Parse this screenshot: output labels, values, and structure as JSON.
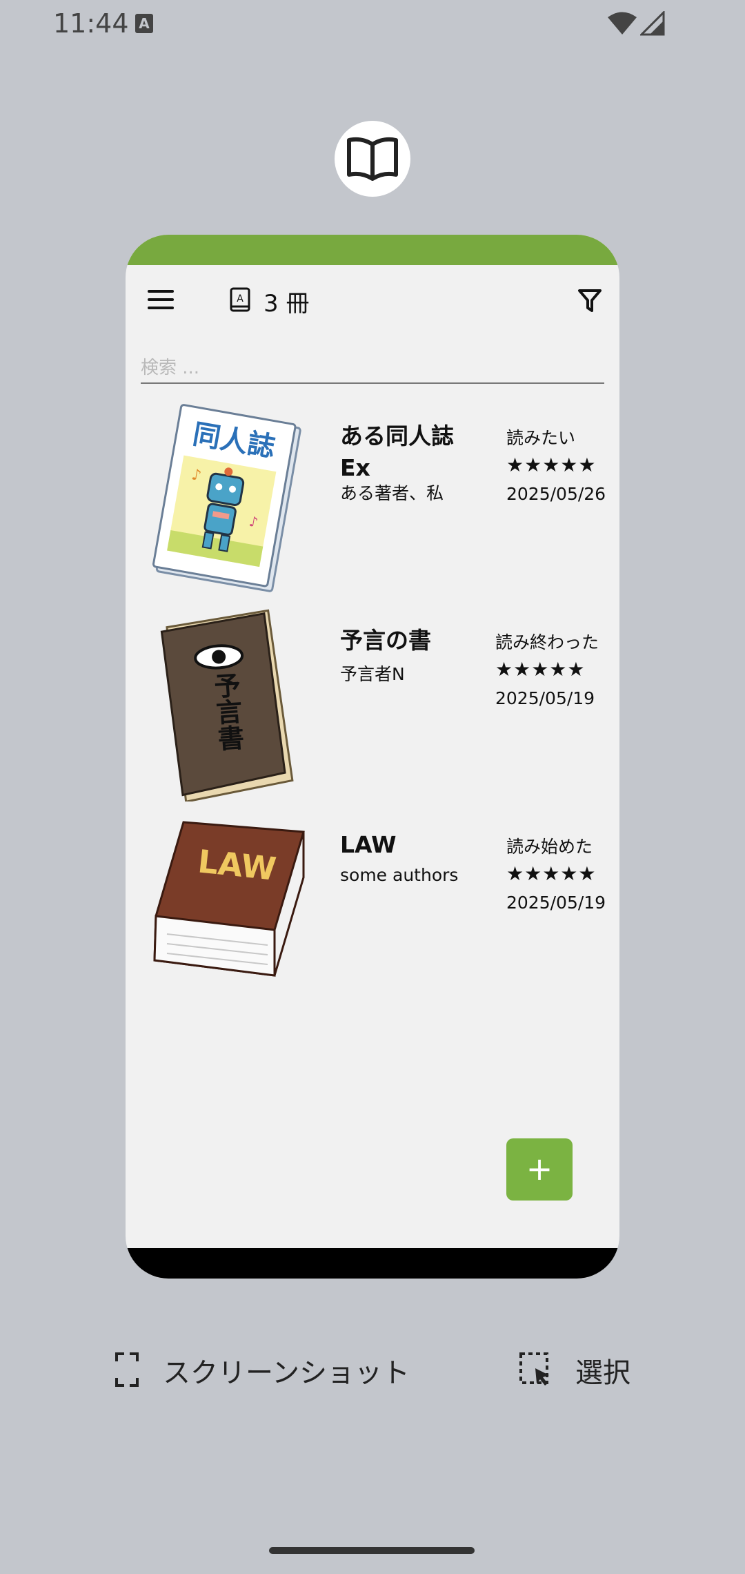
{
  "status_bar": {
    "time": "11:44",
    "notification_glyph": "A"
  },
  "app": {
    "icon": "open-book-icon"
  },
  "toolbar": {
    "book_count": "3 冊"
  },
  "search": {
    "placeholder": "検索 ..."
  },
  "books": [
    {
      "title": "ある同人誌Ex",
      "author": "ある著者、私",
      "status": "読みたい",
      "rating": "★★★★★",
      "date": "2025/05/26",
      "cover": "doujinshi-robot-cover"
    },
    {
      "title": "予言の書",
      "author": "予言者N",
      "status": "読み終わった",
      "rating": "★★★★★",
      "date": "2025/05/19",
      "cover": "prophecy-book-cover"
    },
    {
      "title": "LAW",
      "author": "some authors",
      "status": "読み始めた",
      "rating": "★★★★★",
      "date": "2025/05/19",
      "cover": "law-book-cover"
    }
  ],
  "cover_text": {
    "doujinshi": "同人誌",
    "prophecy": "予言書",
    "law": "LAW"
  },
  "fab": {
    "label": "+"
  },
  "actions": {
    "screenshot_label": "スクリーンショット",
    "select_label": "選択"
  },
  "colors": {
    "accent": "#78a93f",
    "fab": "#7bb342",
    "background": "#c3c6cc",
    "card": "#f1f1f1"
  }
}
